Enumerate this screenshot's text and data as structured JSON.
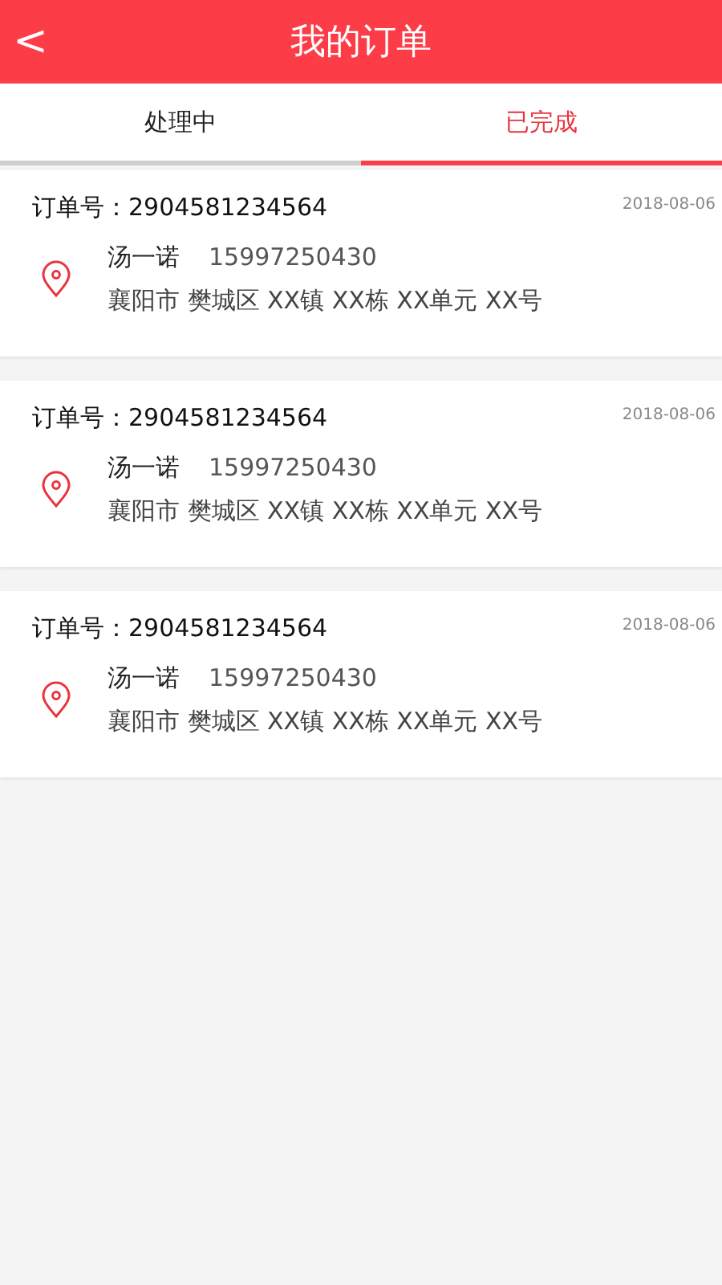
{
  "header": {
    "back": "<",
    "title": "我的订单"
  },
  "tabs": [
    {
      "label": "处理中",
      "selected": false
    },
    {
      "label": "已完成",
      "selected": true
    }
  ],
  "orders": [
    {
      "order_no": "订单号：2904581234564",
      "date": "2018-08-06",
      "name": "汤一诺",
      "phone": "15997250430",
      "address": "襄阳市 樊城区 XX镇 XX栋 XX单元 XX号"
    },
    {
      "order_no": "订单号：2904581234564",
      "date": "2018-08-06",
      "name": "汤一诺",
      "phone": "15997250430",
      "address": "襄阳市 樊城区 XX镇 XX栋 XX单元 XX号"
    },
    {
      "order_no": "订单号：2904581234564",
      "date": "2018-08-06",
      "name": "汤一诺",
      "phone": "15997250430",
      "address": "襄阳市 樊城区 XX镇 XX栋 XX单元 XX号"
    }
  ]
}
